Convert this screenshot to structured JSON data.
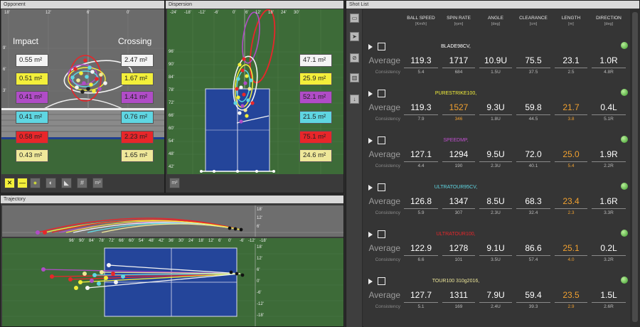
{
  "opponent": {
    "title": "Opponent",
    "scale_top": [
      "18'",
      "12'",
      "6'",
      "0'"
    ],
    "scale_left": [
      "9'",
      "6'",
      "3'"
    ],
    "impact_label": "Impact",
    "crossing_label": "Crossing",
    "impact_areas": [
      "0.55 m²",
      "0.51 m²",
      "0.41 m²",
      "0.41 m²",
      "0.58 m²",
      "0.43 m²"
    ],
    "crossing_areas": [
      "2.47 m²",
      "1.67 m²",
      "1.41 m²",
      "0.76 m²",
      "2.23 m²",
      "1.65 m²"
    ],
    "area_colors": [
      "#f4f4f4",
      "#f3ef3a",
      "#b04cc7",
      "#5fd6e2",
      "#e8262a",
      "#efe89a"
    ],
    "tool_buttons": [
      "✕",
      "—",
      "●",
      "◐",
      "◣",
      "#",
      "m²"
    ]
  },
  "dispersion": {
    "title": "Dispersion",
    "x_scale": [
      "-24'",
      "-18'",
      "-12'",
      "-6'",
      "0'",
      "6'",
      "12'",
      "18'",
      "24'",
      "30'"
    ],
    "y_scale": [
      "96'",
      "90'",
      "84'",
      "78'",
      "72'",
      "66'",
      "60'",
      "54'",
      "48'",
      "42'"
    ],
    "areas": [
      "47.1 m²",
      "25.9 m²",
      "52.1 m²",
      "21.5 m²",
      "75.1 m²",
      "24.6 m²"
    ],
    "tool_button": "m²"
  },
  "trajectory": {
    "title": "Trajectory",
    "x_scale": [
      "96'",
      "90'",
      "84'",
      "78'",
      "72'",
      "66'",
      "60'",
      "54'",
      "48'",
      "42'",
      "36'",
      "30'",
      "24'",
      "18'",
      "12'",
      "6'",
      "0'",
      "-6'",
      "-12'",
      "-18'"
    ],
    "side_scale_top": [
      "18'",
      "12'",
      "6'"
    ],
    "side_scale_bottom": [
      "18'",
      "12'",
      "6'",
      "0'",
      "-6'",
      "-12'",
      "-18'"
    ]
  },
  "shot_list": {
    "title": "Shot List",
    "columns": [
      {
        "name": "BALL SPEED",
        "unit": "[Km/h]"
      },
      {
        "name": "SPIN RATE",
        "unit": "[rpm]"
      },
      {
        "name": "ANGLE",
        "unit": "[deg]"
      },
      {
        "name": "CLEARANCE",
        "unit": "[cm]"
      },
      {
        "name": "LENGTH",
        "unit": "[m]"
      },
      {
        "name": "DIRECTION",
        "unit": "[deg]"
      }
    ],
    "average_label": "Average",
    "consistency_label": "Consistency",
    "groups": [
      {
        "name": "BLADE98CV,",
        "color": "#ffffff",
        "average": [
          "119.3",
          "1717",
          "10.9U",
          "75.5",
          "23.1",
          "1.0R"
        ],
        "consistency": [
          "5.4",
          "684",
          "1.5U",
          "37.5",
          "2.5",
          "4.8R"
        ],
        "orange": []
      },
      {
        "name": "PURESTRIKE100,",
        "color": "#f3ef3a",
        "average": [
          "119.3",
          "1527",
          "9.3U",
          "59.8",
          "21.7",
          "0.4L"
        ],
        "consistency": [
          "7.9",
          "346",
          "1.8U",
          "44.5",
          "3.8",
          "5.1R"
        ],
        "orange": [
          1,
          4
        ]
      },
      {
        "name": "SPEEDMP,",
        "color": "#c050d0",
        "average": [
          "127.1",
          "1294",
          "9.5U",
          "72.0",
          "25.0",
          "1.9R"
        ],
        "consistency": [
          "4.4",
          "190",
          "2.3U",
          "40.1",
          "5.4",
          "2.2R"
        ],
        "orange": [
          4
        ]
      },
      {
        "name": "ULTRATOUR95CV,",
        "color": "#5fd6e2",
        "average": [
          "126.8",
          "1347",
          "8.5U",
          "68.3",
          "23.4",
          "1.6R"
        ],
        "consistency": [
          "5.9",
          "307",
          "2.3U",
          "32.4",
          "2.3",
          "3.3R"
        ],
        "orange": [
          4
        ]
      },
      {
        "name": "ULTRATOUR100,",
        "color": "#e8262a",
        "average": [
          "122.9",
          "1278",
          "9.1U",
          "86.6",
          "25.1",
          "0.2L"
        ],
        "consistency": [
          "6.6",
          "101",
          "3.5U",
          "57.4",
          "4.0",
          "3.2R"
        ],
        "orange": [
          4
        ]
      },
      {
        "name": "TOUR100 310g2016,",
        "color": "#efe89a",
        "average": [
          "127.7",
          "1311",
          "7.9U",
          "59.4",
          "23.5",
          "1.5L"
        ],
        "consistency": [
          "5.1",
          "169",
          "2.4U",
          "39.3",
          "2.9",
          "2.6R"
        ],
        "orange": [
          4
        ]
      }
    ]
  }
}
